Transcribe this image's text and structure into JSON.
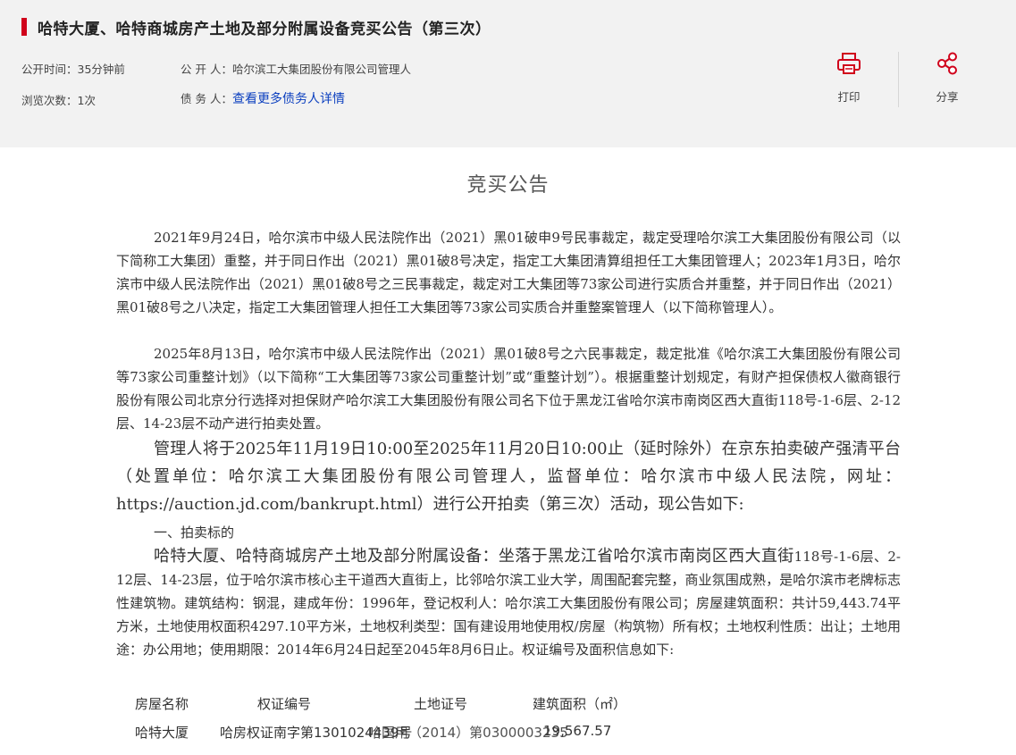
{
  "header": {
    "title": "哈特大厦、哈特商城房产土地及部分附属设备竞买公告（第三次）",
    "publish_time_label": "公开时间：",
    "publish_time_value": "35分钟前",
    "views_label": "浏览次数：",
    "views_value": "1次",
    "publisher_label": "公 开 人：",
    "publisher_value": "哈尔滨工大集团股份有限公司管理人",
    "debtor_label": "债 务 人：",
    "debtor_link": "查看更多债务人详情",
    "actions": {
      "print_label": "打印",
      "share_label": "分享"
    },
    "icons": {
      "print": "printer-icon",
      "share": "share-icon"
    },
    "accent_color": "#d0021b"
  },
  "document": {
    "title": "竞买公告",
    "para1": "2021年9月24日，哈尔滨市中级人民法院作出（2021）黑01破申9号民事裁定，裁定受理哈尔滨工大集团股份有限公司（以下简称工大集团）重整，并于同日作出（2021）黑01破8号决定，指定工大集团清算组担任工大集团管理人；2023年1月3日，哈尔滨市中级人民法院作出（2021）黑01破8号之三民事裁定，裁定对工大集团等73家公司进行实质合并重整，并于同日作出（2021）黑01破8号之八决定，指定工大集团管理人担任工大集团等73家公司实质合并重整案管理人（以下简称管理人）。",
    "para2": "2025年8月13日，哈尔滨市中级人民法院作出（2021）黑01破8号之六民事裁定，裁定批准《哈尔滨工大集团股份有限公司等73家公司重整计划》（以下简称“工大集团等73家公司重整计划”或“重整计划”）。根据重整计划规定，有财产担保债权人徽商银行股份有限公司北京分行选择对担保财产哈尔滨工大集团股份有限公司名下位于黑龙江省哈尔滨市南岗区西大直街118号-1-6层、2-12层、14-23层不动产进行拍卖处置。",
    "para3": "管理人将于2025年11月19日10:00至2025年11月20日10:00止（延时除外）在京东拍卖破产强清平台（处置单位：哈尔滨工大集团股份有限公司管理人，监督单位：哈尔滨市中级人民法院，网址：https://auction.jd.com/bankrupt.html）进行公开拍卖（第三次）活动，现公告如下:",
    "section1_heading": "一、拍卖标的",
    "para4_lead": "哈特大厦、哈特商城房产土地及部分附属设备：坐落于黑龙江省哈尔滨市南岗区西大直街",
    "para4_rest": "118号-1-6层、2-12层、14-23层，位于哈尔滨市核心主干道西大直街上，比邻哈尔滨工业大学，周围配套完整，商业氛围成熟，是哈尔滨市老牌标志性建筑物。建筑结构：钢混，建成年份：1996年，登记权利人：哈尔滨工大集团股份有限公司；房屋建筑面积：共计59,443.74平方米，土地使用权面积4297.10平方米，土地权利类型：国有建设用地使用权/房屋（构筑物）所有权；土地权利性质：出让；土地用途：办公用地；使用期限：2014年6月24日起至2045年8月6日止。权证编号及面积信息如下:",
    "table": {
      "headers": [
        "房屋名称",
        "权证编号",
        "土地证号",
        "建筑面积（㎡）"
      ],
      "rows": [
        [
          "哈特大厦",
          "哈房权证南字第1301024439号",
          "哈国用（2014）第0300003235",
          "19,567.57"
        ]
      ]
    }
  }
}
